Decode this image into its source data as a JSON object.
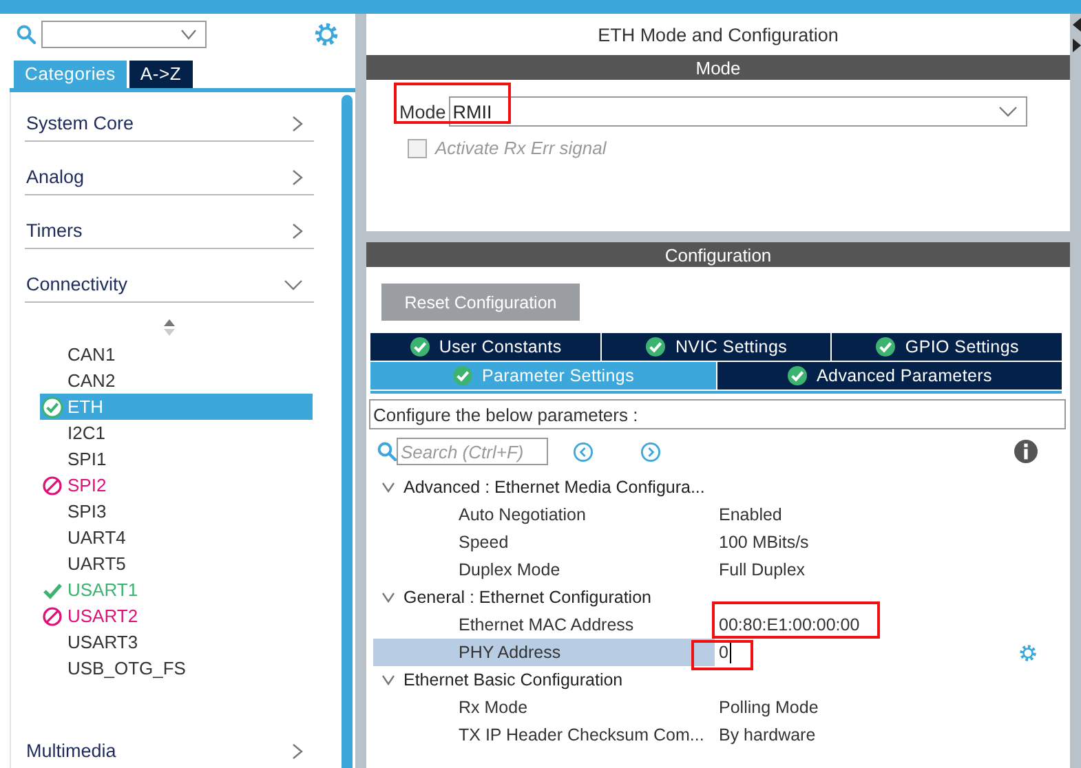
{
  "sidebar": {
    "tabs": [
      {
        "label": "Categories",
        "selected": true
      },
      {
        "label": "A->Z",
        "selected": false
      }
    ],
    "categories": [
      {
        "label": "System Core",
        "expanded": false
      },
      {
        "label": "Analog",
        "expanded": false
      },
      {
        "label": "Timers",
        "expanded": false
      },
      {
        "label": "Connectivity",
        "expanded": true,
        "children": [
          {
            "label": "CAN1",
            "kind": "plain",
            "selected": false
          },
          {
            "label": "CAN2",
            "kind": "plain",
            "selected": false
          },
          {
            "label": "ETH",
            "kind": "configured",
            "selected": true
          },
          {
            "label": "I2C1",
            "kind": "plain",
            "selected": false
          },
          {
            "label": "SPI1",
            "kind": "plain",
            "selected": false
          },
          {
            "label": "SPI2",
            "kind": "conflict",
            "selected": false
          },
          {
            "label": "SPI3",
            "kind": "plain",
            "selected": false
          },
          {
            "label": "UART4",
            "kind": "plain",
            "selected": false
          },
          {
            "label": "UART5",
            "kind": "plain",
            "selected": false
          },
          {
            "label": "USART1",
            "kind": "enabled",
            "selected": false
          },
          {
            "label": "USART2",
            "kind": "conflict",
            "selected": false
          },
          {
            "label": "USART3",
            "kind": "plain",
            "selected": false
          },
          {
            "label": "USB_OTG_FS",
            "kind": "plain",
            "selected": false
          }
        ]
      },
      {
        "label": "Multimedia",
        "expanded": false
      }
    ]
  },
  "mode_panel": {
    "title": "ETH Mode and Configuration",
    "header": "Mode",
    "mode": {
      "label": "Mode",
      "value": "RMII",
      "annotated": true
    },
    "checkbox": {
      "label": "Activate Rx Err signal",
      "checked": false,
      "disabled": true
    }
  },
  "config_panel": {
    "header": "Configuration",
    "reset_button": "Reset Configuration",
    "tab_rows": [
      [
        {
          "label": "User Constants",
          "selected": false
        },
        {
          "label": "NVIC Settings",
          "selected": false
        },
        {
          "label": "GPIO Settings",
          "selected": false
        }
      ],
      [
        {
          "label": "Parameter Settings",
          "selected": true
        },
        {
          "label": "Advanced Parameters",
          "selected": false
        }
      ]
    ],
    "description": "Configure the below parameters :",
    "search": {
      "placeholder": "Search (Ctrl+F)"
    },
    "groups": [
      {
        "label": "Advanced : Ethernet Media Configura...",
        "expanded": true,
        "children": [
          {
            "name": "Auto Negotiation",
            "value": "Enabled",
            "selected": false,
            "annotated": false
          },
          {
            "name": "Speed",
            "value": "100 MBits/s",
            "selected": false,
            "annotated": false
          },
          {
            "name": "Duplex Mode",
            "value": "Full Duplex",
            "selected": false,
            "annotated": false
          }
        ]
      },
      {
        "label": "General : Ethernet Configuration",
        "expanded": true,
        "children": [
          {
            "name": "Ethernet MAC Address",
            "value": "00:80:E1:00:00:00",
            "selected": false,
            "annotated": true
          },
          {
            "name": "PHY Address",
            "value": "0",
            "selected": true,
            "annotated": true
          }
        ]
      },
      {
        "label": "Ethernet Basic Configuration",
        "expanded": true,
        "children": [
          {
            "name": "Rx Mode",
            "value": "Polling Mode",
            "selected": false,
            "annotated": false
          },
          {
            "name": "TX IP Header Checksum Com...",
            "value": "By hardware",
            "selected": false,
            "annotated": false
          }
        ]
      }
    ]
  }
}
